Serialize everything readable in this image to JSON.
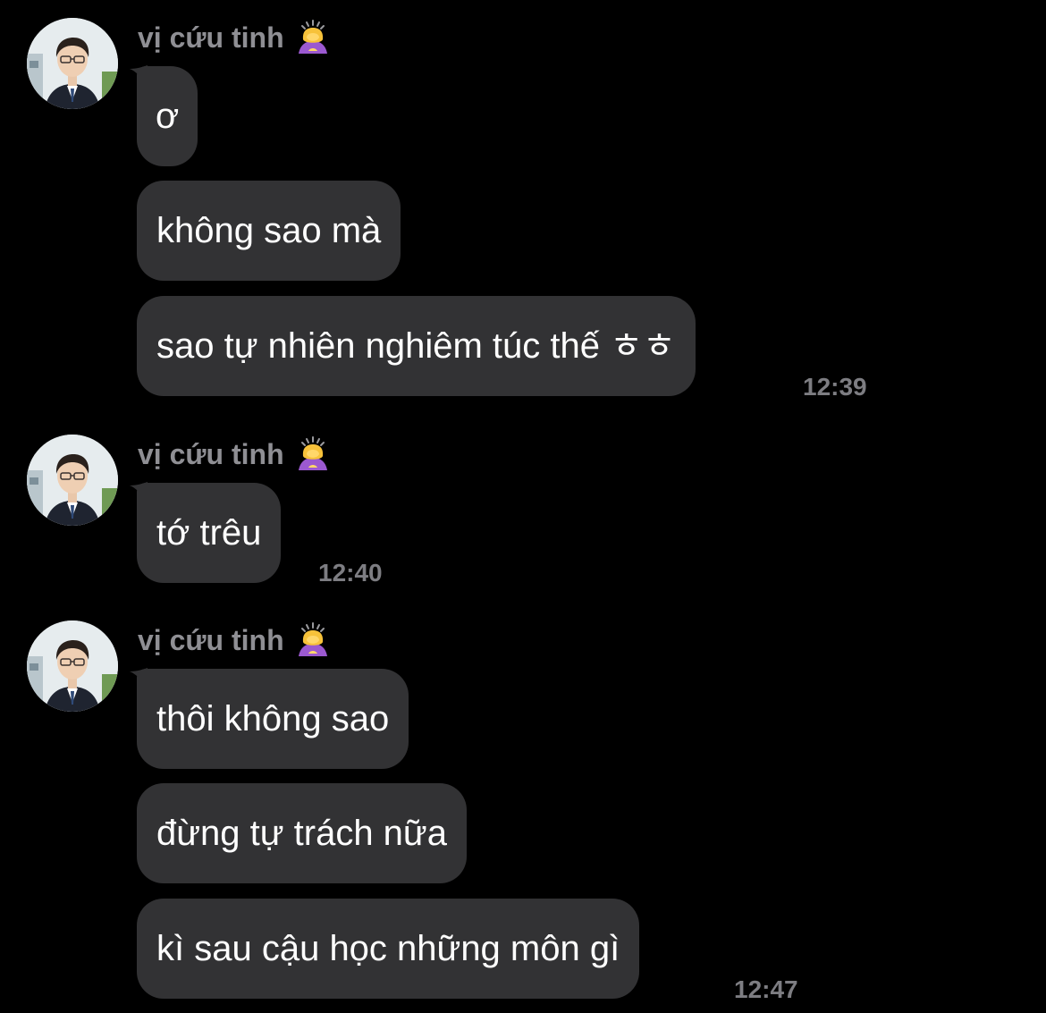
{
  "groups": [
    {
      "sender": "vị cứu tinh",
      "sender_emoji": "person-bowing-emoji",
      "messages": [
        "ơ",
        "không sao mà",
        "sao tự nhiên nghiêm túc thế ㅎㅎ"
      ],
      "time": "12:39"
    },
    {
      "sender": "vị cứu tinh",
      "sender_emoji": "person-bowing-emoji",
      "messages": [
        "tớ trêu"
      ],
      "time": "12:40"
    },
    {
      "sender": "vị cứu tinh",
      "sender_emoji": "person-bowing-emoji",
      "messages": [
        "thôi không sao",
        "đừng tự trách nữa",
        "kì sau cậu học những môn gì"
      ],
      "time": "12:47"
    }
  ],
  "colors": {
    "background": "#000000",
    "bubble": "#323234",
    "message_text": "#ffffff",
    "sender_text": "#8f8f94",
    "time_text": "#7d7d82"
  }
}
